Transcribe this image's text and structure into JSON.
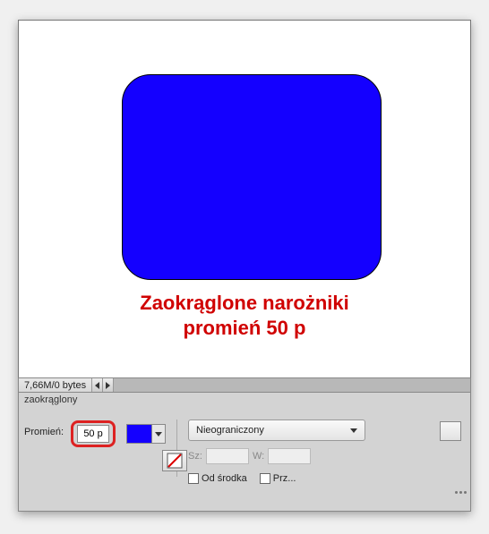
{
  "canvas": {
    "annotation_line1": "Zaokrąglone narożniki",
    "annotation_line2": "promień 50 p",
    "shape_color": "#1400ff"
  },
  "status": {
    "doc_size": "7,66M/0 bytes"
  },
  "options": {
    "tab_label": "zaokrąglony",
    "radius_label": "Promień:",
    "radius_value": "50 p",
    "fill_color": "#1400ff",
    "constrain_label": "Nieograniczony",
    "width_label": "Sz:",
    "width_value": "",
    "height_label": "W:",
    "height_value": "",
    "from_center_label": "Od środka",
    "snap_label": "Prz..."
  }
}
